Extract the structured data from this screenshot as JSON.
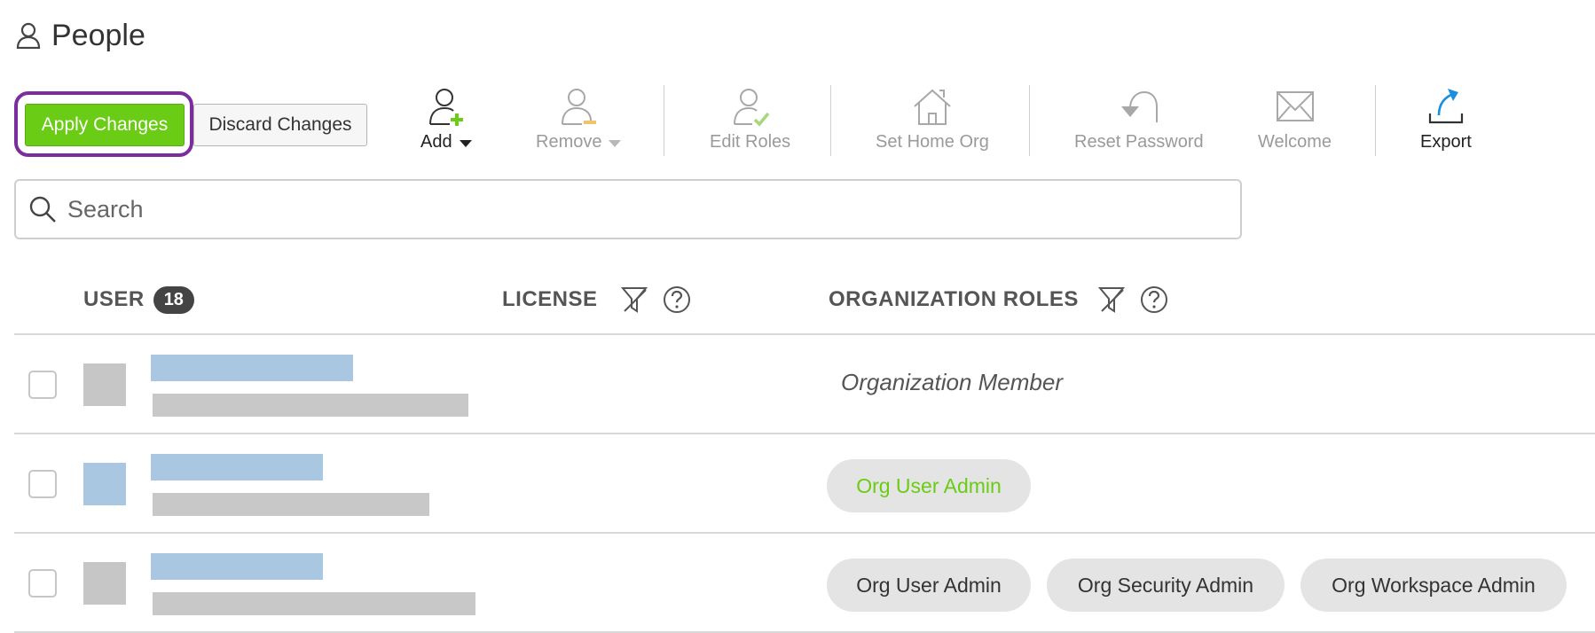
{
  "header": {
    "title": "People",
    "icon": "person-icon"
  },
  "toolbar": {
    "apply_label": "Apply Changes",
    "discard_label": "Discard Changes",
    "add_label": "Add",
    "remove_label": "Remove",
    "edit_roles_label": "Edit Roles",
    "set_home_org_label": "Set Home Org",
    "reset_password_label": "Reset Password",
    "welcome_label": "Welcome",
    "export_label": "Export"
  },
  "search": {
    "placeholder": "Search",
    "value": ""
  },
  "table": {
    "headers": {
      "user": "USER",
      "user_count": "18",
      "license": "LICENSE",
      "org_roles": "ORGANIZATION ROLES"
    },
    "rows": [
      {
        "role_text": "Organization Member",
        "roles": []
      },
      {
        "role_text": "",
        "roles": [
          "Org User Admin"
        ]
      },
      {
        "role_text": "",
        "roles": [
          "Org User Admin",
          "Org Security Admin",
          "Org Workspace Admin"
        ]
      }
    ]
  },
  "colors": {
    "accent_green": "#6acc14",
    "focus_purple": "#7b2d9e",
    "name_blue": "#a9c7e0",
    "redacted_gray": "#c8c8c8",
    "export_blue": "#1a8fe0"
  }
}
